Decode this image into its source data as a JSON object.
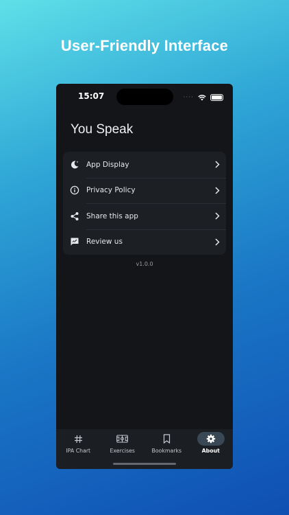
{
  "promo": {
    "headline": "User-Friendly Interface"
  },
  "status": {
    "time": "15:07",
    "signal_dots": "····"
  },
  "app": {
    "title": "You Speak",
    "version": "v1.0.0"
  },
  "menu": {
    "items": [
      {
        "label": "App Display",
        "icon": "moon-icon"
      },
      {
        "label": "Privacy Policy",
        "icon": "info-icon"
      },
      {
        "label": "Share this app",
        "icon": "share-icon"
      },
      {
        "label": "Review us",
        "icon": "review-icon"
      }
    ]
  },
  "tabs": {
    "items": [
      {
        "label": "IPA Chart",
        "icon": "hash-icon",
        "active": false
      },
      {
        "label": "Exercises",
        "icon": "exercises-icon",
        "active": false
      },
      {
        "label": "Bookmarks",
        "icon": "bookmark-icon",
        "active": false
      },
      {
        "label": "About",
        "icon": "gear-icon",
        "active": true
      }
    ]
  },
  "colors": {
    "background_top": "#5fe0e8",
    "background_bottom": "#0f4fb3",
    "surface": "#1c1f23",
    "active_tab": "#3a4754"
  }
}
